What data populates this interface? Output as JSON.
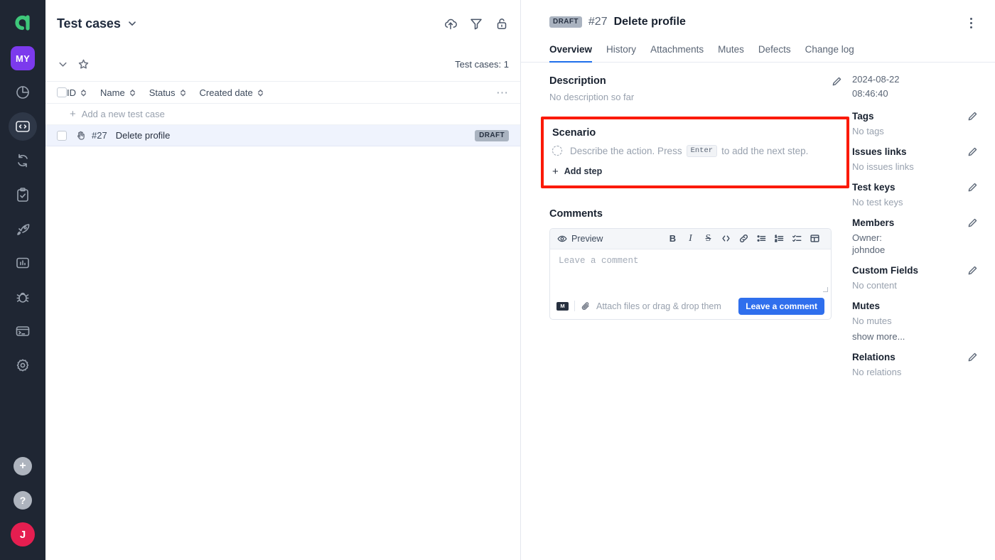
{
  "rail": {
    "logo": {
      "name": "allure-logo",
      "letter": "a"
    },
    "project_badge": "MY",
    "items": [
      {
        "icon": "pie-chart-icon",
        "label": "Dashboards",
        "active": false
      },
      {
        "icon": "code-brackets-icon",
        "label": "Test cases",
        "active": true
      },
      {
        "icon": "refresh-sync-icon",
        "label": "Automated runs",
        "active": false
      },
      {
        "icon": "clipboard-check-icon",
        "label": "Manual launches",
        "active": false
      },
      {
        "icon": "rocket-icon",
        "label": "Launches",
        "active": false
      },
      {
        "icon": "bar-chart-icon",
        "label": "Analytics",
        "active": false
      },
      {
        "icon": "bug-icon",
        "label": "Defects",
        "active": false
      },
      {
        "icon": "terminal-icon",
        "label": "Environments",
        "active": false
      },
      {
        "icon": "gear-icon",
        "label": "Settings",
        "active": false
      }
    ],
    "add_label": "+",
    "help_label": "?",
    "avatar_letter": "J"
  },
  "list_panel": {
    "title": "Test cases",
    "header_icons": [
      "upload-cloud-icon",
      "filter-icon",
      "unlock-icon"
    ],
    "count_label": "Test cases: 1",
    "columns": [
      "ID",
      "Name",
      "Status",
      "Created date"
    ],
    "add_new_label": "Add a new test case",
    "rows": [
      {
        "id": "#27",
        "name": "Delete profile",
        "status": "DRAFT",
        "type_icon": "hand-manual-icon",
        "selected": true
      }
    ]
  },
  "detail": {
    "status_badge": "DRAFT",
    "case_number": "#27",
    "case_name": "Delete profile",
    "tabs": [
      {
        "label": "Overview",
        "active": true
      },
      {
        "label": "History",
        "active": false
      },
      {
        "label": "Attachments",
        "active": false
      },
      {
        "label": "Mutes",
        "active": false
      },
      {
        "label": "Defects",
        "active": false
      },
      {
        "label": "Change log",
        "active": false
      }
    ],
    "description": {
      "title": "Description",
      "empty_text": "No description so far"
    },
    "scenario": {
      "title": "Scenario",
      "placeholder_prefix": "Describe the action. Press",
      "placeholder_key": "Enter",
      "placeholder_suffix": "to add the next step.",
      "add_step_label": "Add step",
      "highlight_color": "#fb1a04"
    },
    "comments": {
      "title": "Comments",
      "preview_label": "Preview",
      "toolbar": [
        "bold-icon",
        "italic-icon",
        "strikethrough-icon",
        "code-icon",
        "link-icon",
        "bullet-list-icon",
        "numbered-list-icon",
        "checklist-icon",
        "table-icon"
      ],
      "placeholder": "Leave a comment",
      "attach_label": "Attach files or drag & drop them",
      "submit_label": "Leave a comment",
      "markdown_badge": "M"
    }
  },
  "aside": {
    "created_date": "2024-08-22",
    "created_time": "08:46:40",
    "blocks": [
      {
        "title": "Tags",
        "value": "No tags",
        "editable": true
      },
      {
        "title": "Issues links",
        "value": "No issues links",
        "editable": true
      },
      {
        "title": "Test keys",
        "value": "No test keys",
        "editable": true
      },
      {
        "title": "Members",
        "value": "Owner:",
        "value2": "johndoe",
        "editable": true
      },
      {
        "title": "Custom Fields",
        "value": "No content",
        "editable": true
      },
      {
        "title": "Mutes",
        "value": "No mutes",
        "extra": "show more...",
        "editable": false
      },
      {
        "title": "Relations",
        "value": "No relations",
        "editable": true
      }
    ]
  }
}
